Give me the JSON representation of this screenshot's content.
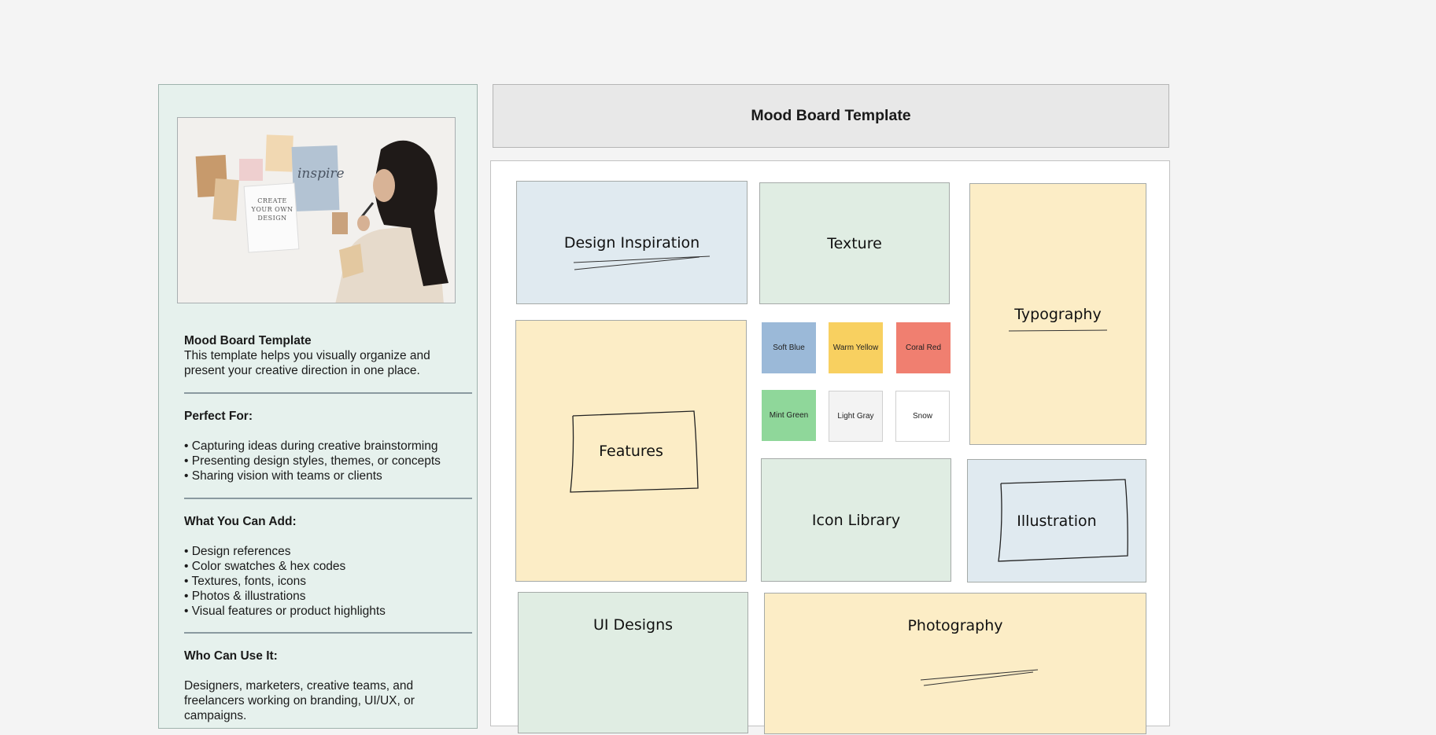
{
  "board": {
    "title": "Mood Board Template",
    "cards": {
      "design_inspiration": "Design Inspiration",
      "texture": "Texture",
      "typography": "Typography",
      "features": "Features",
      "icon_library": "Icon Library",
      "illustration": "Illustration",
      "ui_designs": "UI Designs",
      "photography": "Photography"
    },
    "swatches": [
      {
        "label": "Soft Blue",
        "color": "#9bb9d8"
      },
      {
        "label": "Warm Yellow",
        "color": "#f8d060"
      },
      {
        "label": "Coral Red",
        "color": "#f07f70"
      },
      {
        "label": "Mint Green",
        "color": "#8fd79a"
      },
      {
        "label": "Light Gray",
        "color": "#f3f3f3"
      },
      {
        "label": "Snow",
        "color": "#ffffff"
      }
    ]
  },
  "info": {
    "title": "Mood Board Template",
    "description": "This template helps you visually organize and present your creative direction in one place.",
    "perfect_for": {
      "heading": "Perfect For:",
      "items": [
        "Capturing ideas during creative brainstorming",
        "Presenting design styles, themes, or concepts",
        "Sharing vision with teams or clients"
      ]
    },
    "what_you_can_add": {
      "heading": "What You Can Add:",
      "items": [
        "Design references",
        "Color swatches & hex codes",
        "Textures, fonts, icons",
        "Photos & illustrations",
        "Visual features or product highlights"
      ]
    },
    "who_can_use": {
      "heading": "Who Can Use It:",
      "text": "Designers, marketers, creative teams, and freelancers working on branding, UI/UX, or campaigns."
    },
    "photo": {
      "poster_text": "CREATE YOUR OWN DESIGN",
      "sticky_text": "inspire"
    }
  }
}
